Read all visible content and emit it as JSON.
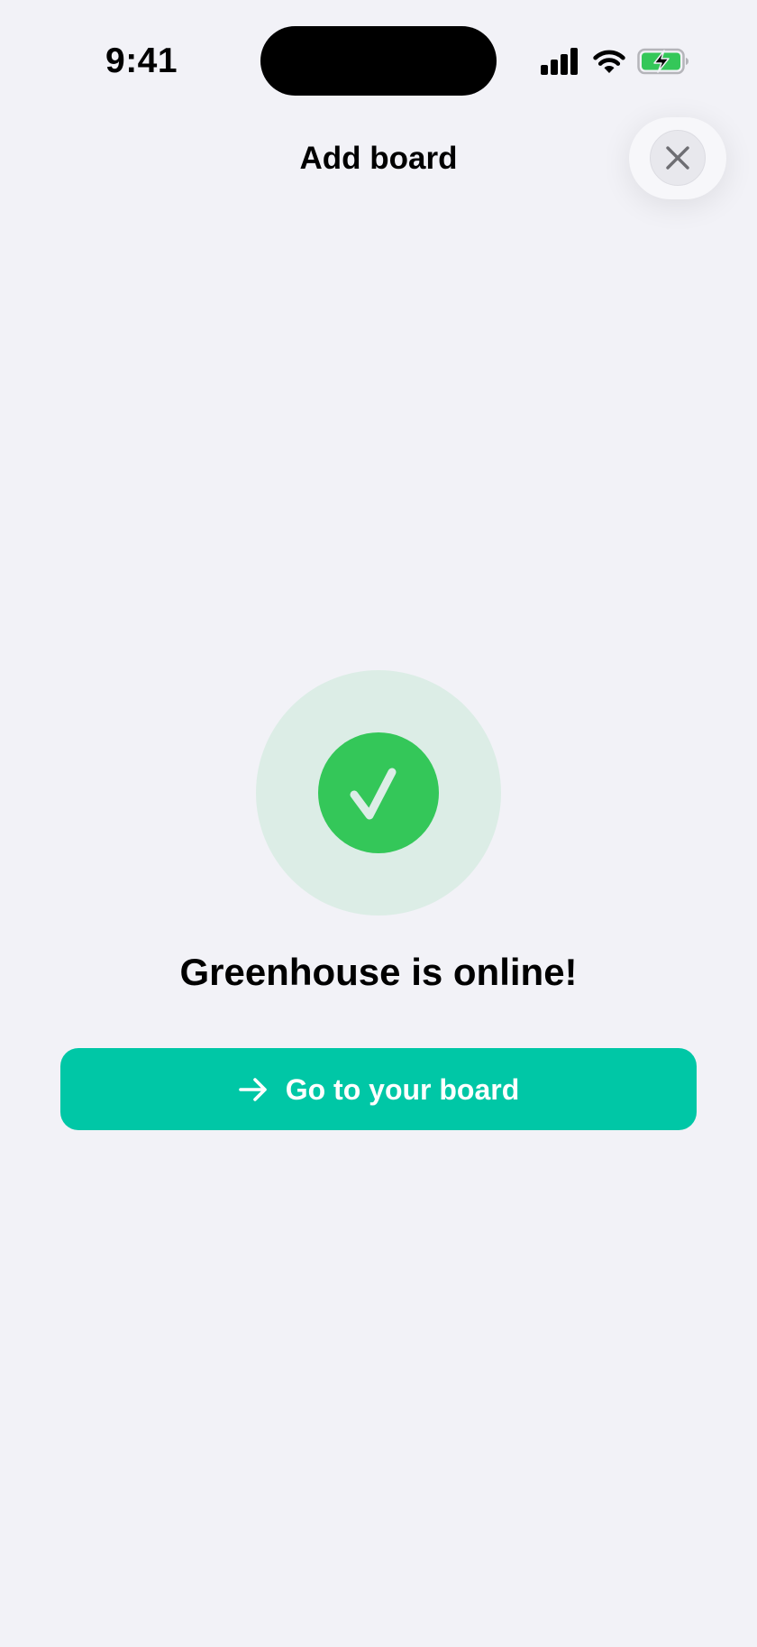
{
  "status_bar": {
    "time": "9:41",
    "icons": [
      "signal-icon",
      "wifi-icon",
      "battery-charging-icon"
    ]
  },
  "header": {
    "title": "Add board",
    "close_icon": "close-icon"
  },
  "success": {
    "icon": "checkmark-icon",
    "message": "Greenhouse is online!"
  },
  "primary_action": {
    "icon": "arrow-right-icon",
    "label": "Go to your board"
  },
  "colors": {
    "background": "#f2f2f7",
    "accent": "#00c7a6",
    "success": "#34c759",
    "success_halo": "#dcede6",
    "battery": "#34c759"
  }
}
